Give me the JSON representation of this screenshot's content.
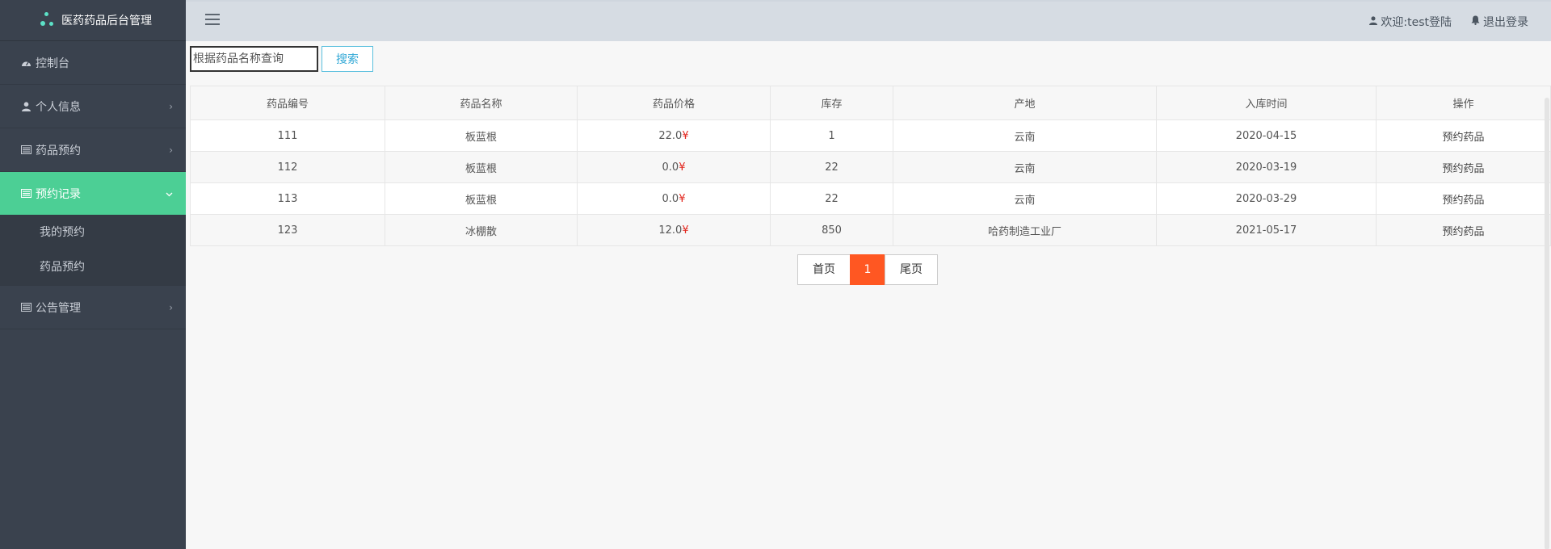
{
  "app": {
    "title": "医药药品后台管理"
  },
  "sidebar": {
    "items": [
      {
        "label": "控制台",
        "icon": "dashboard-icon",
        "chevron": ""
      },
      {
        "label": "个人信息",
        "icon": "user-icon",
        "chevron": "›"
      },
      {
        "label": "药品预约",
        "icon": "list-icon",
        "chevron": "›"
      },
      {
        "label": "预约记录",
        "icon": "list-icon",
        "chevron": "⌄",
        "active": true,
        "children": [
          {
            "label": "我的预约"
          },
          {
            "label": "药品预约"
          }
        ]
      },
      {
        "label": "公告管理",
        "icon": "list-icon",
        "chevron": "›"
      }
    ]
  },
  "header": {
    "welcome": "欢迎:test登陆",
    "logout": "退出登录"
  },
  "search": {
    "placeholder": "根据药品名称查询",
    "button": "搜索"
  },
  "table": {
    "columns": [
      "药品编号",
      "药品名称",
      "药品价格",
      "库存",
      "产地",
      "入库时间",
      "操作"
    ],
    "currency": "¥",
    "rows": [
      {
        "id": "111",
        "name": "板蓝根",
        "price": "22.0",
        "stock": "1",
        "origin": "云南",
        "date": "2020-04-15",
        "action": "预约药品"
      },
      {
        "id": "112",
        "name": "板蓝根",
        "price": "0.0",
        "stock": "22",
        "origin": "云南",
        "date": "2020-03-19",
        "action": "预约药品"
      },
      {
        "id": "113",
        "name": "板蓝根",
        "price": "0.0",
        "stock": "22",
        "origin": "云南",
        "date": "2020-03-29",
        "action": "预约药品"
      },
      {
        "id": "123",
        "name": "冰棚散",
        "price": "12.0",
        "stock": "850",
        "origin": "哈药制造工业厂",
        "date": "2021-05-17",
        "action": "预约药品"
      }
    ]
  },
  "pagination": {
    "first": "首页",
    "current": "1",
    "last": "尾页"
  },
  "colors": {
    "sidebar_bg": "#3a424e",
    "active_bg": "#4ccf95",
    "header_bg": "#d6dce3",
    "page_current": "#ff5722",
    "price_symbol": "#e2231a"
  }
}
